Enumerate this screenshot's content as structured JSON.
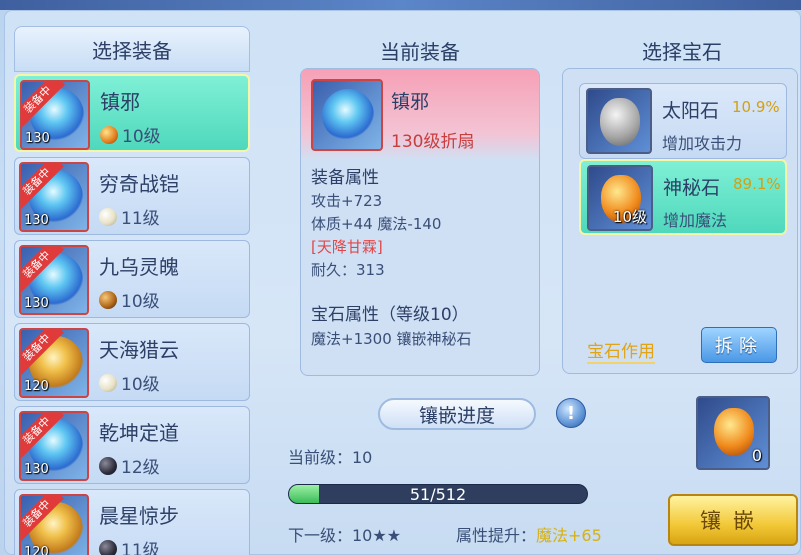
{
  "left_panel": {
    "title": "选择装备",
    "items": [
      {
        "name": "镇邪",
        "badge": "装备中",
        "level": "130",
        "gem_level": "10级",
        "gem": "orange",
        "art": "blue",
        "selected": true
      },
      {
        "name": "穷奇战铠",
        "badge": "装备中",
        "level": "130",
        "gem_level": "11级",
        "gem": "pearl",
        "art": "blue",
        "selected": false
      },
      {
        "name": "九乌灵魄",
        "badge": "装备中",
        "level": "130",
        "gem_level": "10级",
        "gem": "brown",
        "art": "blue",
        "selected": false
      },
      {
        "name": "天海猎云",
        "badge": "装备中",
        "level": "120",
        "gem_level": "10级",
        "gem": "pearl",
        "art": "gold",
        "selected": false
      },
      {
        "name": "乾坤定道",
        "badge": "装备中",
        "level": "130",
        "gem_level": "12级",
        "gem": "dark",
        "art": "blue",
        "selected": false
      },
      {
        "name": "晨星惊步",
        "badge": "装备中",
        "level": "120",
        "gem_level": "11级",
        "gem": "dark",
        "art": "gold",
        "selected": false
      }
    ]
  },
  "current_equip": {
    "title": "当前装备",
    "name": "镇邪",
    "type": "130级折扇",
    "attr_title": "装备属性",
    "attr_lines": [
      "攻击+723",
      "体质+44 魔法-140"
    ],
    "special": "[天降甘霖]",
    "durability": "耐久：313",
    "gem_attr_title": "宝石属性（等级10）",
    "gem_attr_line": "魔法+1300 镶嵌神秘石"
  },
  "gem_select": {
    "title": "选择宝石",
    "gems": [
      {
        "name": "太阳石",
        "rate": "10.9%",
        "desc": "增加攻击力",
        "level": "",
        "stone": "gray",
        "selected": false
      },
      {
        "name": "神秘石",
        "rate": "89.1%",
        "desc": "增加魔法",
        "level": "10级",
        "stone": "orange",
        "selected": true
      }
    ],
    "effect_label": "宝石作用",
    "dismantle_label": "拆除"
  },
  "progress": {
    "title": "镶嵌进度",
    "current_level": "当前级：10",
    "text": "51/512",
    "value": 51,
    "max": 512,
    "next_level_label": "下一级：10",
    "next_level_stars": "★★",
    "attr_up_label": "属性提升：",
    "attr_up_value": "魔法+65"
  },
  "cost": {
    "count": "0"
  },
  "actions": {
    "inlay_label": "镶嵌"
  }
}
